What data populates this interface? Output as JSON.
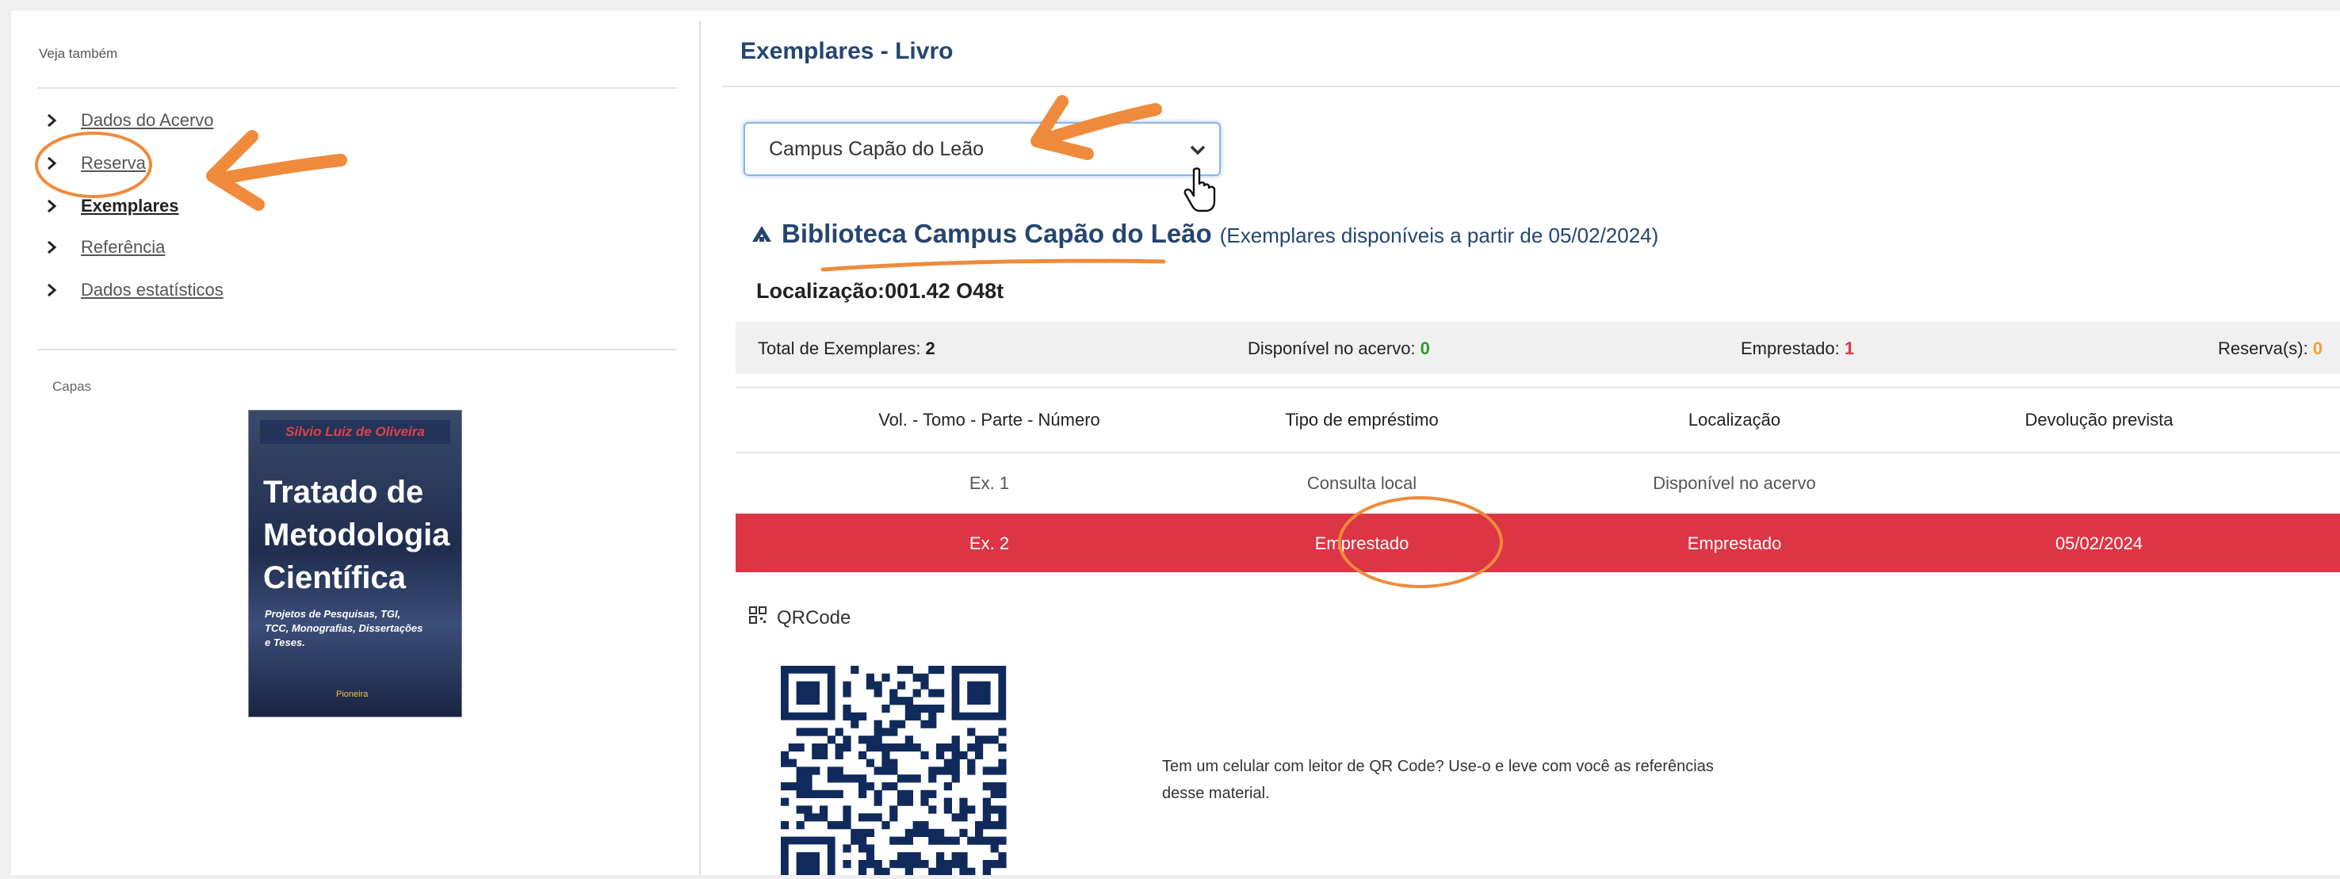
{
  "sidebar": {
    "heading": "Veja também",
    "items": [
      {
        "label": "Dados do Acervo"
      },
      {
        "label": "Reserva"
      },
      {
        "label": "Exemplares"
      },
      {
        "label": "Referência"
      },
      {
        "label": "Dados estatísticos"
      }
    ],
    "capas_heading": "Capas",
    "cover": {
      "author": "Silvio Luiz de Oliveira",
      "title_line1": "Tratado de",
      "title_line2": "Metodologia",
      "title_line3": "Científica",
      "subtitle": "Projetos de Pesquisas, TGI, TCC, Monografias, Dissertações e Teses.",
      "publisher": "Pioneira"
    }
  },
  "main": {
    "title": "Exemplares - Livro",
    "campus_select": {
      "selected": "Campus Capão do Leão"
    },
    "library": {
      "name": "Biblioteca Campus Capão do Leão",
      "note": "(Exemplares disponíveis a partir de 05/02/2024)"
    },
    "location": {
      "label": "Localização:",
      "value": "001.42 O48t"
    },
    "stats": {
      "total_label": "Total de Exemplares: ",
      "total_value": "2",
      "available_label": "Disponível no acervo: ",
      "available_value": "0",
      "loaned_label": "Emprestado: ",
      "loaned_value": "1",
      "reserve_label": "Reserva(s): ",
      "reserve_value": "0"
    },
    "table": {
      "headers": [
        "Vol. - Tomo - Parte - Número",
        "Tipo de empréstimo",
        "Localização",
        "Devolução prevista"
      ],
      "rows": [
        [
          "Ex. 1",
          "Consulta local",
          "Disponível no acervo",
          ""
        ],
        [
          "Ex. 2",
          "Emprestado",
          "Emprestado",
          "05/02/2024"
        ]
      ]
    },
    "qrcode": {
      "label": "QRCode",
      "text": "Tem um celular com leitor de QR Code? Use-o e leve com você as referências desse material."
    }
  },
  "colors": {
    "title_blue": "#24466e",
    "loan_red": "#dc3545",
    "available_green": "#2a9d2a",
    "annotation_orange": "#f08a3c"
  },
  "icons": [
    "chevron-right-icon",
    "chevron-down-icon",
    "library-icon",
    "qrcode-icon",
    "hand-cursor-icon"
  ]
}
